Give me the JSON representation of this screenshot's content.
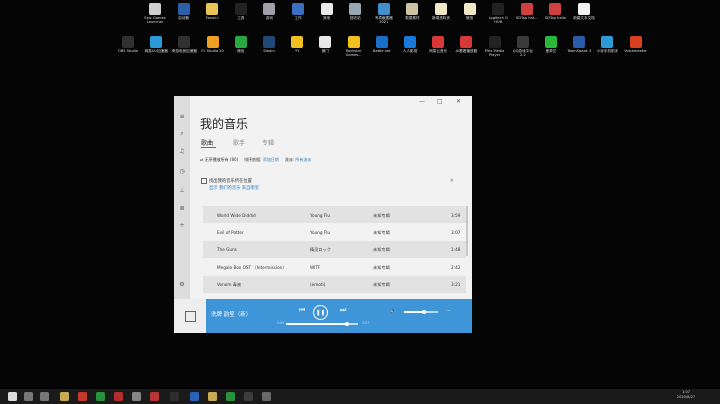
{
  "desktop": {
    "row1": [
      {
        "label": "Epic Games Launcher",
        "color": "#d0d0d0"
      },
      {
        "label": "启动器",
        "color": "#2a5fa8"
      },
      {
        "label": "Fanuk.l",
        "color": "#e8c45a"
      },
      {
        "label": "工具",
        "color": "#222222"
      },
      {
        "label": "游戏",
        "color": "#a0a0a8"
      },
      {
        "label": "工作",
        "color": "#3a6fc2"
      },
      {
        "label": "其他",
        "color": "#eaeaea"
      },
      {
        "label": "回收站",
        "color": "#9aa8b4"
      },
      {
        "label": "专项截图器 2021",
        "color": "#3f8fcf"
      },
      {
        "label": "数据素材",
        "color": "#cfc4a0"
      },
      {
        "label": "新增资料夹",
        "color": "#f0e8c8"
      },
      {
        "label": "微信",
        "color": "#f0e8c8"
      },
      {
        "label": "Logitech G HUB",
        "color": "#222222"
      },
      {
        "label": "SDTap hat...",
        "color": "#d04040"
      },
      {
        "label": "SDTap hello",
        "color": "#d04040"
      },
      {
        "label": "新建文本文档",
        "color": "#f2f2f2"
      }
    ],
    "row2": [
      {
        "label": "OBS Studio",
        "color": "#303030"
      },
      {
        "label": "网易UU加速器",
        "color": "#2a9ad8"
      },
      {
        "label": "奇游电竞加速器",
        "color": "#303030"
      },
      {
        "label": "FL Studio 20",
        "color": "#f0a020"
      },
      {
        "label": "微信",
        "color": "#2aa840"
      },
      {
        "label": "Steam",
        "color": "#1f4a78"
      },
      {
        "label": "YY",
        "color": "#f0c020"
      },
      {
        "label": "微门",
        "color": "#e8e8e8"
      },
      {
        "label": "Rockstar Games...",
        "color": "#f0c020"
      },
      {
        "label": "Battle.net",
        "color": "#1a70c8"
      },
      {
        "label": "人人影视",
        "color": "#1a78d8"
      },
      {
        "label": "网易云音乐",
        "color": "#d83838"
      },
      {
        "label": "Ai看看播放器",
        "color": "#d83838"
      },
      {
        "label": "Plex Media Player",
        "color": "#222222"
      },
      {
        "label": "QQ游戏平台 2.2",
        "color": "#3a3a3a"
      },
      {
        "label": "爱奇艺",
        "color": "#2ab838"
      },
      {
        "label": "TeamSpeak 3",
        "color": "#2a5aa8"
      },
      {
        "label": "小米手机助手",
        "color": "#2a9ad8"
      },
      {
        "label": "Voicemeeter",
        "color": "#d84020"
      }
    ]
  },
  "app": {
    "title": "我的音乐",
    "controls": {
      "minimize": "—",
      "maximize": "□",
      "close": "✕"
    },
    "tabs": [
      {
        "label": "歌曲",
        "active": true
      },
      {
        "label": "歌手",
        "active": false
      },
      {
        "label": "专辑",
        "active": false
      }
    ],
    "filters": {
      "shuffle_label": "无序播放所有 (80)",
      "sort_label": "排序依据:",
      "sort_value": "添加日期",
      "genre_label": "流派:",
      "genre_value": "所有流派"
    },
    "banner": {
      "line1": "找出我的音乐所在位置",
      "line2": "显示 我们的音乐 来自哪里",
      "dismiss": "✕"
    },
    "songs": [
      {
        "title": "World Wide Diddid",
        "artist": "Young Flu",
        "album": "未知专辑",
        "duration": "3:59"
      },
      {
        "title": "Evil of Potter",
        "artist": "Young Flu",
        "album": "未知专辑",
        "duration": "3:07"
      },
      {
        "title": "The Guns",
        "artist": "精灵ロック",
        "album": "未知专辑",
        "duration": "1:48"
      },
      {
        "title": "Megalo Box OST （Intermission）",
        "artist": "WITF",
        "album": "未知专辑",
        "duration": "2:42"
      },
      {
        "title": "Venom 毒液",
        "artist": "(emoti)",
        "album": "未知专辑",
        "duration": "3:21"
      }
    ],
    "player": {
      "now_playing": "洗牌 韵笙（新）",
      "time_elapsed": "2:03",
      "time_total": "3:07",
      "progress": 0.85,
      "volume": 0.6
    }
  },
  "taskbar": {
    "clock_time": "1:07",
    "clock_date": "2020/8/27"
  },
  "colors": {
    "accent": "#3e95d8",
    "link": "#2d7fc9"
  }
}
